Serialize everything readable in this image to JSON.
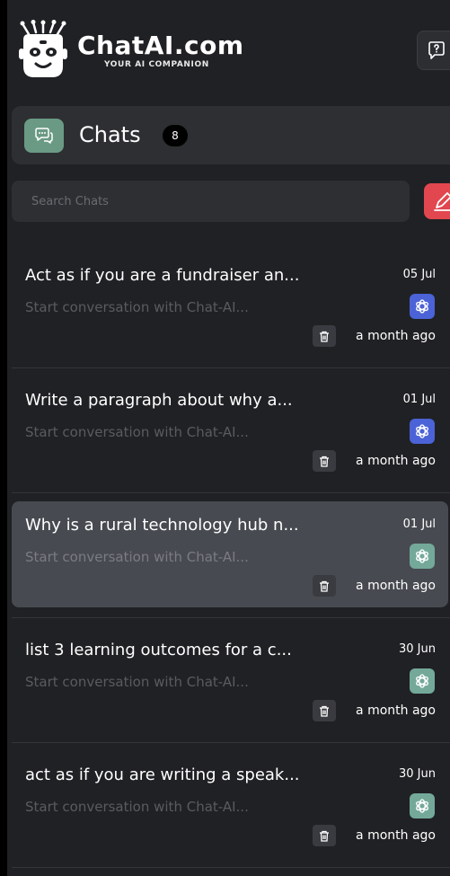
{
  "brand": {
    "name": "ChatAI.com",
    "tagline": "YOUR AI COMPANION"
  },
  "chats_header": {
    "title": "Chats",
    "count": "8"
  },
  "search": {
    "placeholder": "Search Chats"
  },
  "chats": [
    {
      "title": "Act as if you are a fundraiser an...",
      "date": "05 Jul",
      "subtitle": "Start conversation with Chat-AI...",
      "time_ago": "a month ago",
      "model_icon": "openai-icon",
      "model_color": "#4b63d6",
      "active": false
    },
    {
      "title": "Write a paragraph about why a...",
      "date": "01 Jul",
      "subtitle": "Start conversation with Chat-AI...",
      "time_ago": "a month ago",
      "model_icon": "openai-icon",
      "model_color": "#4b63d6",
      "active": false
    },
    {
      "title": "Why is a rural technology hub n...",
      "date": "01 Jul",
      "subtitle": "Start conversation with Chat-AI...",
      "time_ago": "a month ago",
      "model_icon": "openai-icon",
      "model_color": "#74a99a",
      "active": true
    },
    {
      "title": "list 3 learning outcomes for a c...",
      "date": "30 Jun",
      "subtitle": "Start conversation with Chat-AI...",
      "time_ago": "a month ago",
      "model_icon": "openai-icon",
      "model_color": "#74a99a",
      "active": false
    },
    {
      "title": "act as if you are writing a speak...",
      "date": "30 Jun",
      "subtitle": "Start conversation with Chat-AI...",
      "time_ago": "a month ago",
      "model_icon": "openai-icon",
      "model_color": "#74a99a",
      "active": false
    }
  ],
  "colors": {
    "panel_bg": "#202124",
    "active_row": "#474a50",
    "chats_icon_bg": "#6a9a84",
    "new_chat_button": "#e2474f"
  }
}
